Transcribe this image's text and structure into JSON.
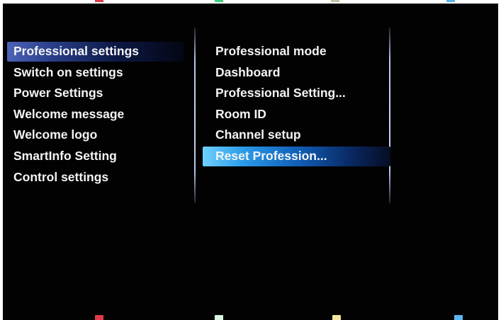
{
  "left_menu": {
    "items": [
      {
        "label": "Professional settings",
        "selected": true
      },
      {
        "label": "Switch on settings"
      },
      {
        "label": "Power Settings"
      },
      {
        "label": "Welcome message"
      },
      {
        "label": "Welcome logo"
      },
      {
        "label": "SmartInfo Setting"
      },
      {
        "label": "Control settings"
      }
    ]
  },
  "right_menu": {
    "items": [
      {
        "label": "Professional mode"
      },
      {
        "label": "Dashboard"
      },
      {
        "label": "Professional Setting..."
      },
      {
        "label": "Room ID"
      },
      {
        "label": "Channel setup"
      },
      {
        "label": "Reset Profession...",
        "focused": true
      }
    ]
  },
  "color_keys": {
    "red": "#e23a4a",
    "green": "#3fd07a",
    "yellow": "#f3e6a0",
    "blue": "#5ab7f0"
  }
}
